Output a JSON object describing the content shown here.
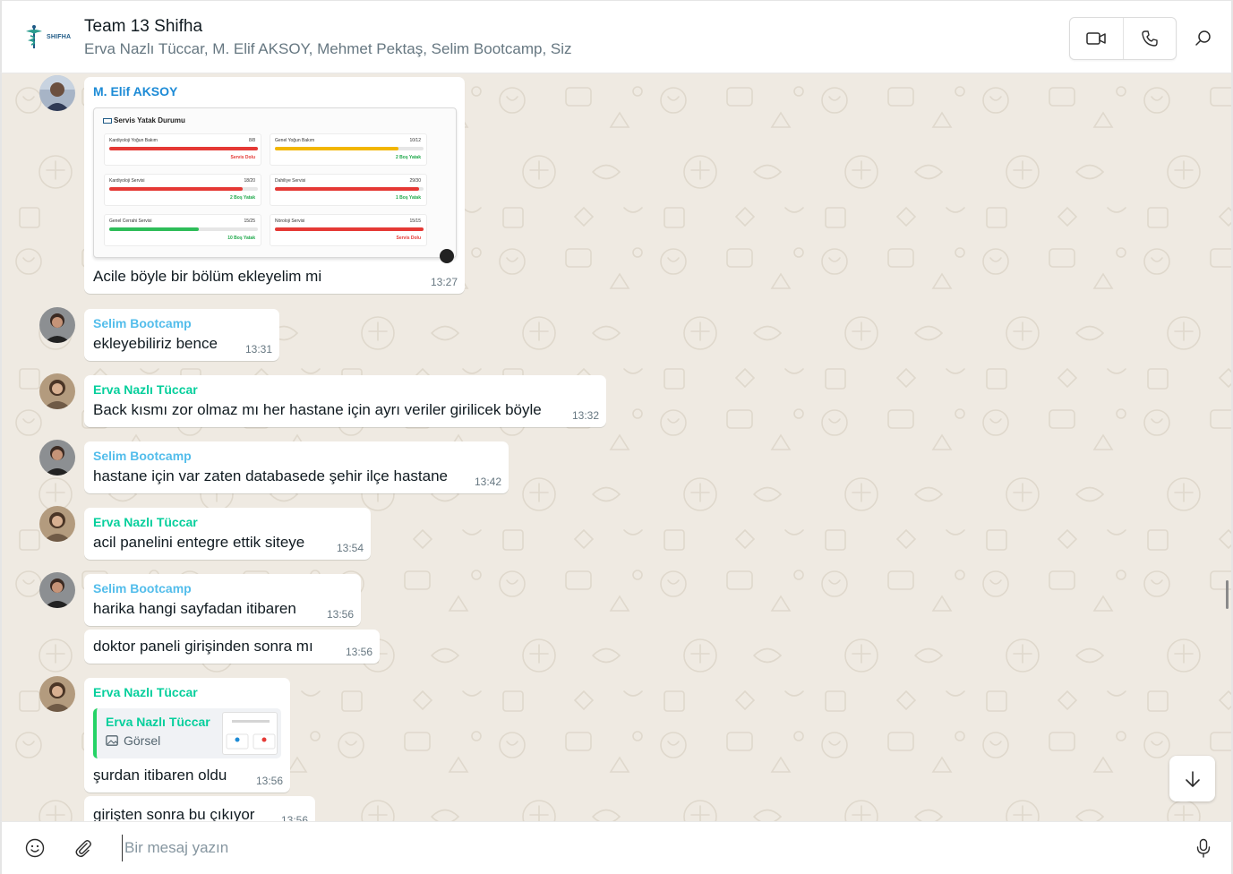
{
  "header": {
    "logo_text": "SHIFHA",
    "title": "Team 13 Shifha",
    "members": "Erva Nazlı Tüccar, M. Elif AKSOY, Mehmet Pektaş, Selim Bootcamp, Siz"
  },
  "messages": [
    {
      "sender": "M. Elif AKSOY",
      "text": "Acile böyle bir bölüm ekleyelim mi",
      "time": "13:27"
    },
    {
      "sender": "Selim Bootcamp",
      "text": "ekleyebiliriz bence",
      "time": "13:31"
    },
    {
      "sender": "Erva Nazlı Tüccar",
      "text": "Back kısmı zor olmaz mı her hastane için ayrı veriler girilicek böyle",
      "time": "13:32"
    },
    {
      "sender": "Selim Bootcamp",
      "text": "hastane için var zaten databasede şehir ilçe hastane",
      "time": "13:42"
    },
    {
      "sender": "Erva Nazlı Tüccar",
      "text": "acil panelini entegre ettik siteye",
      "time": "13:54"
    },
    {
      "sender": "Selim Bootcamp",
      "text": "harika hangi sayfadan itibaren",
      "time": "13:56"
    },
    {
      "sender": "",
      "text": "doktor paneli girişinden sonra mı",
      "time": "13:56"
    },
    {
      "sender": "Erva Nazlı Tüccar",
      "text": "şurdan itibaren oldu",
      "time": "13:56"
    },
    {
      "sender": "",
      "text": "girişten sonra bu çıkıyor",
      "time": "13:56"
    }
  ],
  "embed": {
    "title": "Servis Yatak Durumu",
    "wards": [
      {
        "name": "Kardiyoloji Yoğun Bakım",
        "count": "8/8",
        "status": "Servis Dolu",
        "fill": 1.0,
        "color": "#e53935",
        "status_color": "#e53935"
      },
      {
        "name": "Genel Yoğun Bakım",
        "count": "10/12",
        "status": "2 Boş Yatak",
        "fill": 0.83,
        "color": "#f2b600",
        "status_color": "#1ea84a"
      },
      {
        "name": "Kardiyoloji Servisi",
        "count": "18/20",
        "status": "2 Boş Yatak",
        "fill": 0.9,
        "color": "#e53935",
        "status_color": "#1ea84a"
      },
      {
        "name": "Dahiliye Servisi",
        "count": "29/30",
        "status": "1 Boş Yatak",
        "fill": 0.97,
        "color": "#e53935",
        "status_color": "#1ea84a"
      },
      {
        "name": "Genel Cerrahi Servisi",
        "count": "15/25",
        "status": "10 Boş Yatak",
        "fill": 0.6,
        "color": "#2ebd59",
        "status_color": "#1ea84a"
      },
      {
        "name": "Nöroloji Servisi",
        "count": "15/15",
        "status": "Servis Dolu",
        "fill": 1.0,
        "color": "#e53935",
        "status_color": "#e53935"
      }
    ]
  },
  "quote": {
    "name": "Erva Nazlı Tüccar",
    "type": "Görsel"
  },
  "footer": {
    "placeholder": "Bir mesaj yazın"
  },
  "colors": {
    "chat_bg": "#efeae2",
    "sender_elif": "#1d8bd6",
    "sender_selim": "#53bdeb",
    "sender_erva": "#06cf9c"
  },
  "icons": [
    "video-call-icon",
    "voice-call-icon",
    "search-icon",
    "emoji-icon",
    "attach-icon",
    "mic-icon",
    "arrow-down-icon",
    "image-icon"
  ]
}
